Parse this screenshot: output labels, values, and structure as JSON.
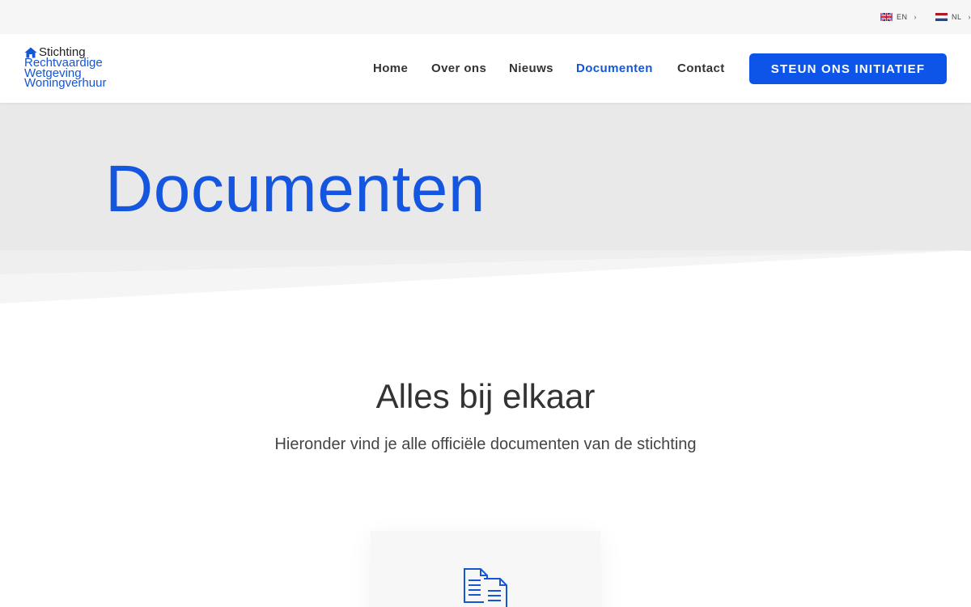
{
  "topbar": {
    "languages": [
      {
        "code": "EN",
        "flag": "uk-flag-icon"
      },
      {
        "code": "NL",
        "flag": "nl-flag-icon"
      }
    ]
  },
  "logo": {
    "line1": "Stichting",
    "line2": "Rechtvaardige",
    "line3": "Wetgeving",
    "line4": "Woningverhuur",
    "icon": "house-icon"
  },
  "nav": {
    "items": [
      {
        "label": "Home"
      },
      {
        "label": "Over ons"
      },
      {
        "label": "Nieuws"
      },
      {
        "label": "Documenten"
      },
      {
        "label": "Contact"
      }
    ],
    "active": "Documenten",
    "cta_label": "STEUN ONS INITIATIEF"
  },
  "hero": {
    "title": "Documenten"
  },
  "content": {
    "title": "Alles bij elkaar",
    "subtitle": "Hieronder vind je alle officiële documenten van de stichting",
    "card_icon": "documents-icon"
  },
  "colors": {
    "accent": "#0d55e8",
    "hero_bg": "#e9e9e9",
    "topbar_bg": "#f6f6f6"
  }
}
